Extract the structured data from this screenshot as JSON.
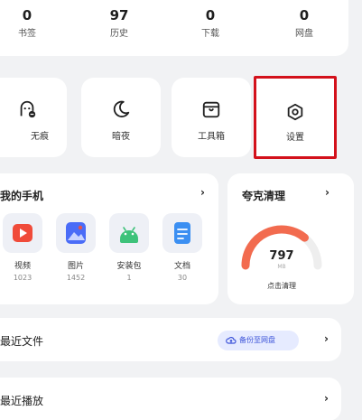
{
  "stats": [
    {
      "value": "0",
      "label": "书签"
    },
    {
      "value": "97",
      "label": "历史"
    },
    {
      "value": "0",
      "label": "下载"
    },
    {
      "value": "0",
      "label": "网盘"
    }
  ],
  "tiles": [
    {
      "label": "无痕",
      "icon": "incognito-icon"
    },
    {
      "label": "暗夜",
      "icon": "moon-icon"
    },
    {
      "label": "工具箱",
      "icon": "toolbox-icon"
    },
    {
      "label": "设置",
      "icon": "settings-icon"
    }
  ],
  "my_phone": {
    "title": "我的手机",
    "apps": [
      {
        "name": "视频",
        "count": "1023",
        "icon": "video-icon",
        "color": "#f04b3a"
      },
      {
        "name": "图片",
        "count": "1452",
        "icon": "image-icon",
        "color": "#4a6cf7"
      },
      {
        "name": "安装包",
        "count": "1",
        "icon": "android-icon",
        "color": "#3ec27a"
      },
      {
        "name": "文档",
        "count": "30",
        "icon": "document-icon",
        "color": "#3b8ff2"
      }
    ]
  },
  "cleaner": {
    "title": "夸克清理",
    "value": "797",
    "unit": "MB",
    "action": "点击清理",
    "level": 0.72,
    "color": "#f26b4f"
  },
  "recent_files": {
    "label": "最近文件",
    "backup": "备份至网盘"
  },
  "recent_play": {
    "label": "最近播放"
  },
  "chevron": "›"
}
